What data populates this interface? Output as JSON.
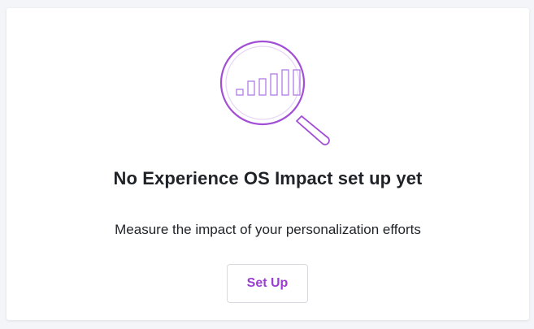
{
  "empty_state": {
    "icon": "magnifier-bar-chart-icon",
    "title": "No Experience OS Impact set up yet",
    "subtitle": "Measure the impact of your personalization efforts",
    "button_label": "Set Up"
  },
  "colors": {
    "accent": "#9b3fd1",
    "accent_light": "#b27be3",
    "text": "#1f2328",
    "background": "#f3f5f8"
  }
}
